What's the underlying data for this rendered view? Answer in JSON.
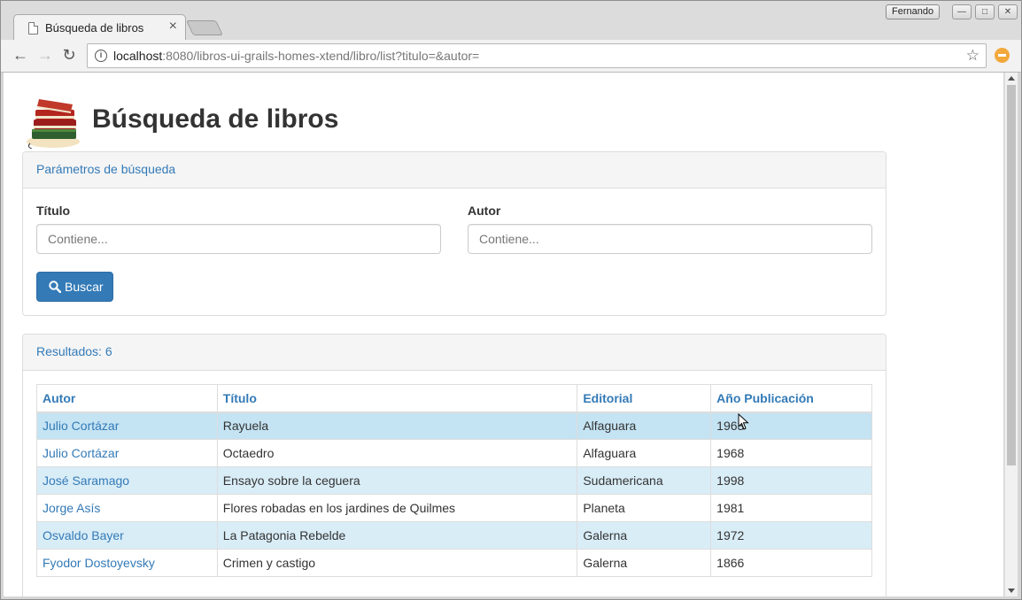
{
  "browser": {
    "tab_title": "Búsqueda de libros",
    "tab_close": "×",
    "profile_name": "Fernando",
    "url_host": "localhost",
    "url_rest": ":8080/libros-ui-grails-homes-xtend/libro/list?titulo=&autor=",
    "icons": [
      "back-arrow-icon",
      "forward-arrow-icon",
      "reload-icon",
      "info-icon",
      "star-icon",
      "extension-icon"
    ],
    "accent_color": "#f3a83b"
  },
  "page": {
    "title": "Búsqueda de libros",
    "logo_icon": "books-logo-icon"
  },
  "search": {
    "heading": "Parámetros de búsqueda",
    "titulo_label": "Título",
    "titulo_placeholder": "Contiene...",
    "titulo_value": "",
    "autor_label": "Autor",
    "autor_placeholder": "Contiene...",
    "autor_value": "",
    "button_label": "Buscar",
    "button_color": "#337ab7"
  },
  "results": {
    "heading": "Resultados: 6",
    "columns": [
      "Autor",
      "Título",
      "Editorial",
      "Año Publicación"
    ],
    "rows": [
      {
        "autor": "Julio Cortázar",
        "titulo": "Rayuela",
        "editorial": "Alfaguara",
        "anio": "1963"
      },
      {
        "autor": "Julio Cortázar",
        "titulo": "Octaedro",
        "editorial": "Alfaguara",
        "anio": "1968"
      },
      {
        "autor": "José Saramago",
        "titulo": "Ensayo sobre la ceguera",
        "editorial": "Sudamericana",
        "anio": "1998"
      },
      {
        "autor": "Jorge Asís",
        "titulo": "Flores robadas en los jardines de Quilmes",
        "editorial": "Planeta",
        "anio": "1981"
      },
      {
        "autor": "Osvaldo Bayer",
        "titulo": "La Patagonia Rebelde",
        "editorial": "Galerna",
        "anio": "1972"
      },
      {
        "autor": "Fyodor Dostoyevsky",
        "titulo": "Crimen y castigo",
        "editorial": "Galerna",
        "anio": "1866"
      }
    ],
    "link_color": "#337ab7",
    "stripe_color": "#d9edf7",
    "hover_color": "#c4e3f3"
  }
}
